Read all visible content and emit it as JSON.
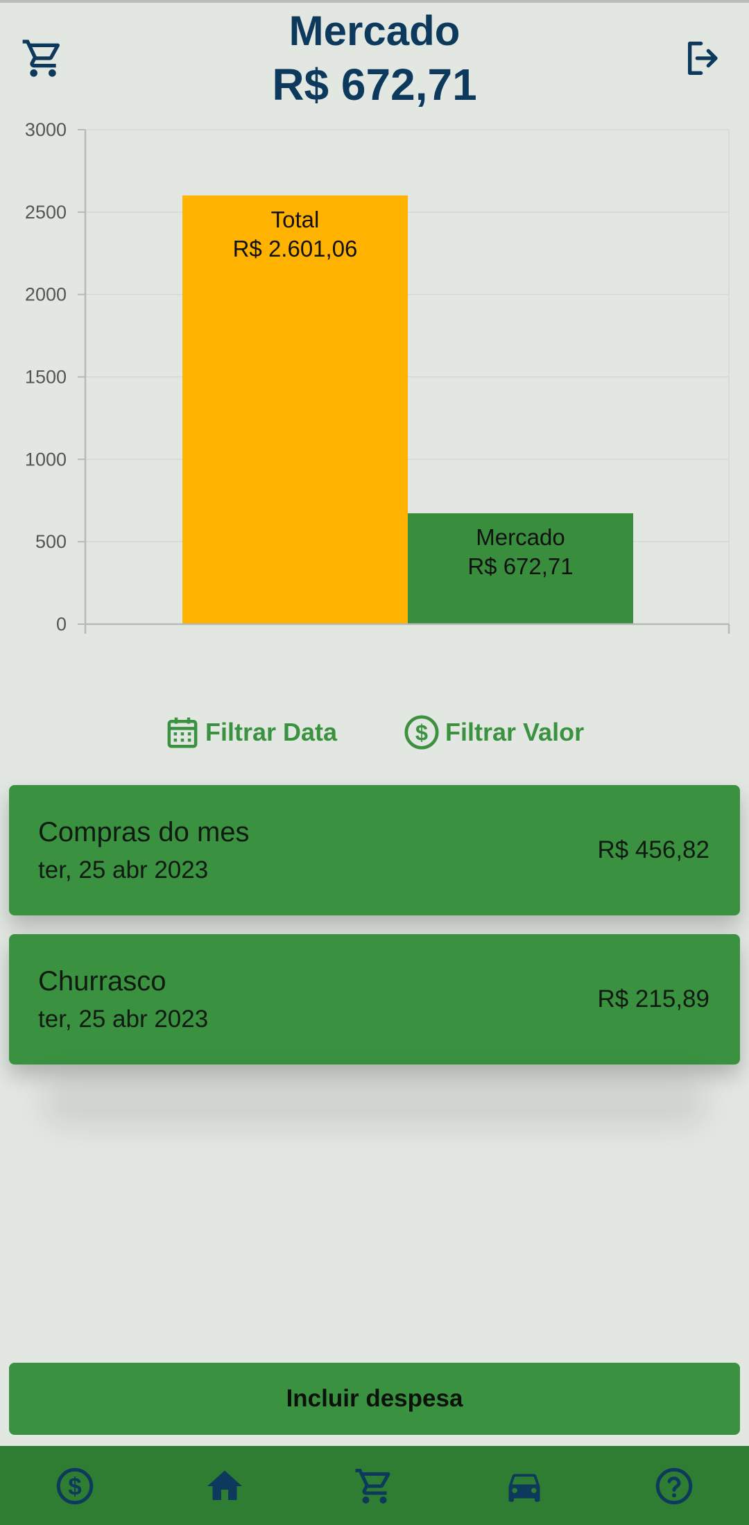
{
  "header": {
    "title": "Mercado",
    "amount": "R$ 672,71",
    "left_icon": "cart-icon",
    "right_icon": "logout-icon"
  },
  "colors": {
    "background": "#e2e7e2",
    "title_blue": "#0d3a5c",
    "green": "#3a9140",
    "nav_green": "#2e7d32",
    "bar_total": "#ffb300",
    "bar_category": "#388e3c"
  },
  "chart_data": {
    "type": "bar",
    "categories": [
      "Total",
      "Mercado"
    ],
    "values": [
      2601.06,
      672.71
    ],
    "value_labels": [
      "R$ 2.601,06",
      "R$ 672,71"
    ],
    "colors": [
      "#ffb300",
      "#388e3c"
    ],
    "ylim": [
      0,
      3000
    ],
    "yticks": [
      "0",
      "500",
      "1000",
      "1500",
      "2000",
      "2500",
      "3000"
    ],
    "grid": true,
    "title": "",
    "xlabel": "",
    "ylabel": ""
  },
  "filters": {
    "date_label": "Filtrar Data",
    "date_icon": "calendar-icon",
    "value_label": "Filtrar Valor",
    "value_icon": "dollar-circle-icon"
  },
  "expenses": [
    {
      "name": "Compras do mes",
      "date": "ter, 25 abr 2023",
      "value": "R$ 456,82"
    },
    {
      "name": "Churrasco",
      "date": "ter, 25 abr 2023",
      "value": "R$ 215,89"
    }
  ],
  "add_button": {
    "label": "Incluir despesa"
  },
  "bottom_nav": {
    "items": [
      "dollar-circle-icon",
      "home-icon",
      "cart-icon",
      "car-icon",
      "help-circle-icon"
    ]
  }
}
